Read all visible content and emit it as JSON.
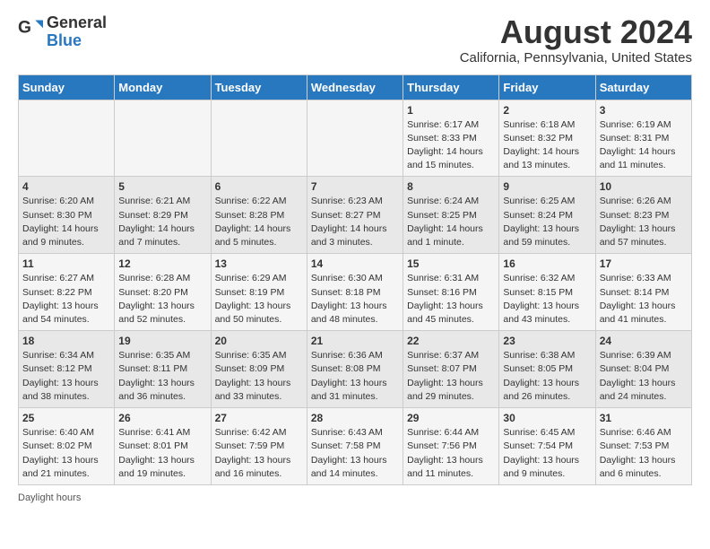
{
  "logo": {
    "text1": "General",
    "text2": "Blue"
  },
  "title": "August 2024",
  "subtitle": "California, Pennsylvania, United States",
  "days_of_week": [
    "Sunday",
    "Monday",
    "Tuesday",
    "Wednesday",
    "Thursday",
    "Friday",
    "Saturday"
  ],
  "weeks": [
    [
      {
        "day": "",
        "detail": ""
      },
      {
        "day": "",
        "detail": ""
      },
      {
        "day": "",
        "detail": ""
      },
      {
        "day": "",
        "detail": ""
      },
      {
        "day": "1",
        "detail": "Sunrise: 6:17 AM\nSunset: 8:33 PM\nDaylight: 14 hours and 15 minutes."
      },
      {
        "day": "2",
        "detail": "Sunrise: 6:18 AM\nSunset: 8:32 PM\nDaylight: 14 hours and 13 minutes."
      },
      {
        "day": "3",
        "detail": "Sunrise: 6:19 AM\nSunset: 8:31 PM\nDaylight: 14 hours and 11 minutes."
      }
    ],
    [
      {
        "day": "4",
        "detail": "Sunrise: 6:20 AM\nSunset: 8:30 PM\nDaylight: 14 hours and 9 minutes."
      },
      {
        "day": "5",
        "detail": "Sunrise: 6:21 AM\nSunset: 8:29 PM\nDaylight: 14 hours and 7 minutes."
      },
      {
        "day": "6",
        "detail": "Sunrise: 6:22 AM\nSunset: 8:28 PM\nDaylight: 14 hours and 5 minutes."
      },
      {
        "day": "7",
        "detail": "Sunrise: 6:23 AM\nSunset: 8:27 PM\nDaylight: 14 hours and 3 minutes."
      },
      {
        "day": "8",
        "detail": "Sunrise: 6:24 AM\nSunset: 8:25 PM\nDaylight: 14 hours and 1 minute."
      },
      {
        "day": "9",
        "detail": "Sunrise: 6:25 AM\nSunset: 8:24 PM\nDaylight: 13 hours and 59 minutes."
      },
      {
        "day": "10",
        "detail": "Sunrise: 6:26 AM\nSunset: 8:23 PM\nDaylight: 13 hours and 57 minutes."
      }
    ],
    [
      {
        "day": "11",
        "detail": "Sunrise: 6:27 AM\nSunset: 8:22 PM\nDaylight: 13 hours and 54 minutes."
      },
      {
        "day": "12",
        "detail": "Sunrise: 6:28 AM\nSunset: 8:20 PM\nDaylight: 13 hours and 52 minutes."
      },
      {
        "day": "13",
        "detail": "Sunrise: 6:29 AM\nSunset: 8:19 PM\nDaylight: 13 hours and 50 minutes."
      },
      {
        "day": "14",
        "detail": "Sunrise: 6:30 AM\nSunset: 8:18 PM\nDaylight: 13 hours and 48 minutes."
      },
      {
        "day": "15",
        "detail": "Sunrise: 6:31 AM\nSunset: 8:16 PM\nDaylight: 13 hours and 45 minutes."
      },
      {
        "day": "16",
        "detail": "Sunrise: 6:32 AM\nSunset: 8:15 PM\nDaylight: 13 hours and 43 minutes."
      },
      {
        "day": "17",
        "detail": "Sunrise: 6:33 AM\nSunset: 8:14 PM\nDaylight: 13 hours and 41 minutes."
      }
    ],
    [
      {
        "day": "18",
        "detail": "Sunrise: 6:34 AM\nSunset: 8:12 PM\nDaylight: 13 hours and 38 minutes."
      },
      {
        "day": "19",
        "detail": "Sunrise: 6:35 AM\nSunset: 8:11 PM\nDaylight: 13 hours and 36 minutes."
      },
      {
        "day": "20",
        "detail": "Sunrise: 6:35 AM\nSunset: 8:09 PM\nDaylight: 13 hours and 33 minutes."
      },
      {
        "day": "21",
        "detail": "Sunrise: 6:36 AM\nSunset: 8:08 PM\nDaylight: 13 hours and 31 minutes."
      },
      {
        "day": "22",
        "detail": "Sunrise: 6:37 AM\nSunset: 8:07 PM\nDaylight: 13 hours and 29 minutes."
      },
      {
        "day": "23",
        "detail": "Sunrise: 6:38 AM\nSunset: 8:05 PM\nDaylight: 13 hours and 26 minutes."
      },
      {
        "day": "24",
        "detail": "Sunrise: 6:39 AM\nSunset: 8:04 PM\nDaylight: 13 hours and 24 minutes."
      }
    ],
    [
      {
        "day": "25",
        "detail": "Sunrise: 6:40 AM\nSunset: 8:02 PM\nDaylight: 13 hours and 21 minutes."
      },
      {
        "day": "26",
        "detail": "Sunrise: 6:41 AM\nSunset: 8:01 PM\nDaylight: 13 hours and 19 minutes."
      },
      {
        "day": "27",
        "detail": "Sunrise: 6:42 AM\nSunset: 7:59 PM\nDaylight: 13 hours and 16 minutes."
      },
      {
        "day": "28",
        "detail": "Sunrise: 6:43 AM\nSunset: 7:58 PM\nDaylight: 13 hours and 14 minutes."
      },
      {
        "day": "29",
        "detail": "Sunrise: 6:44 AM\nSunset: 7:56 PM\nDaylight: 13 hours and 11 minutes."
      },
      {
        "day": "30",
        "detail": "Sunrise: 6:45 AM\nSunset: 7:54 PM\nDaylight: 13 hours and 9 minutes."
      },
      {
        "day": "31",
        "detail": "Sunrise: 6:46 AM\nSunset: 7:53 PM\nDaylight: 13 hours and 6 minutes."
      }
    ]
  ],
  "footer": "Daylight hours"
}
